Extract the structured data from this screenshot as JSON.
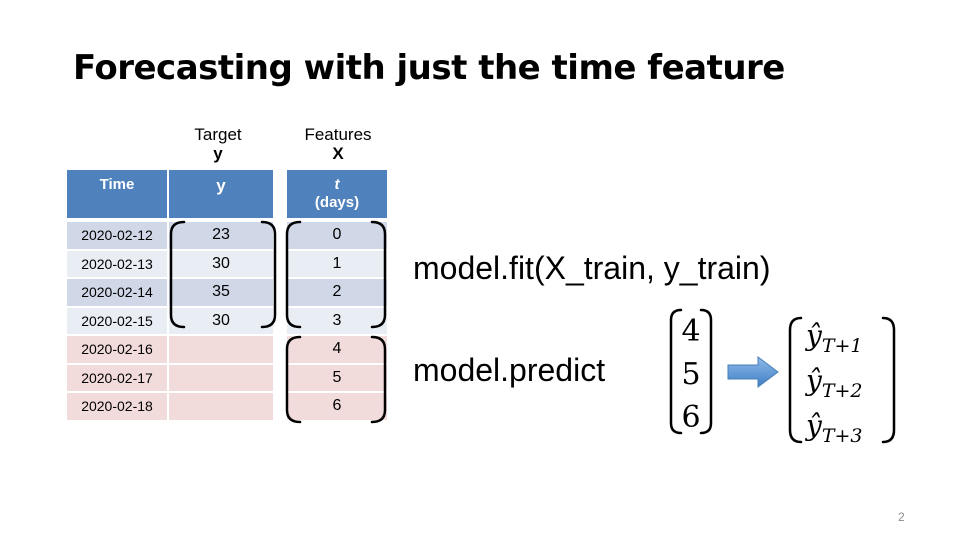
{
  "slide": {
    "title": "Forecasting with just the time feature",
    "page_number": "2"
  },
  "headers": {
    "target_label": "Target",
    "target_symbol": "y",
    "features_label": "Features",
    "features_symbol": "X"
  },
  "table": {
    "columns": [
      "Time",
      "y",
      "t",
      "(days)"
    ],
    "train_rows": [
      {
        "time": "2020-02-12",
        "y": "23",
        "t": "0"
      },
      {
        "time": "2020-02-13",
        "y": "30",
        "t": "1"
      },
      {
        "time": "2020-02-14",
        "y": "35",
        "t": "2"
      },
      {
        "time": "2020-02-15",
        "y": "30",
        "t": "3"
      }
    ],
    "test_rows": [
      {
        "time": "2020-02-16",
        "y": "",
        "t": "4"
      },
      {
        "time": "2020-02-17",
        "y": "",
        "t": "5"
      },
      {
        "time": "2020-02-18",
        "y": "",
        "t": "6"
      }
    ]
  },
  "code": {
    "fit": "model.fit(X_train, y_train)",
    "predict": "model.predict"
  },
  "predict_input": [
    "4",
    "5",
    "6"
  ],
  "predict_output": [
    {
      "symbol": "ŷ",
      "subscript": "T+1"
    },
    {
      "symbol": "ŷ",
      "subscript": "T+2"
    },
    {
      "symbol": "ŷ",
      "subscript": "T+3"
    }
  ],
  "colors": {
    "header_blue": "#4f81bd",
    "row_blue_dark": "#d0d8e8",
    "row_blue_light": "#e9edf4",
    "row_pink": "#f2dcdb",
    "arrow_blue": "#5b9bd5"
  }
}
